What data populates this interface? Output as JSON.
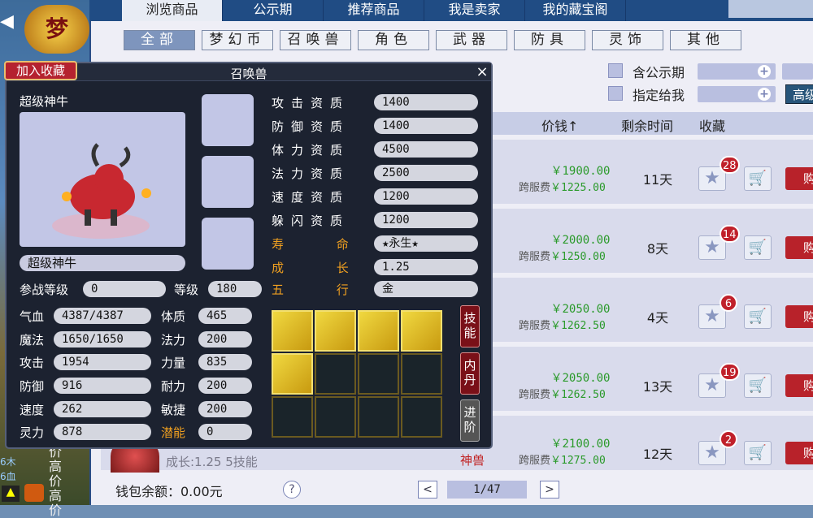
{
  "tabs": [
    "浏览商品",
    "公示期",
    "推荐商品",
    "我是卖家",
    "我的藏宝阁"
  ],
  "categories": [
    "全部",
    "梦幻币",
    "召唤兽",
    "角色",
    "武器",
    "防具",
    "灵饰",
    "其他"
  ],
  "filters": {
    "public": "含公示期",
    "assign": "指定给我",
    "advanced": "高级"
  },
  "table": {
    "price": "价钱↑",
    "remaining": "剩余时间",
    "favorite": "收藏"
  },
  "rows": [
    {
      "price": "￥1900.00",
      "fee_label": "跨服费",
      "fee": "￥1225.00",
      "days": "11天",
      "favs": "28"
    },
    {
      "price": "￥2000.00",
      "fee_label": "跨服费",
      "fee": "￥1250.00",
      "days": "8天",
      "favs": "14"
    },
    {
      "price": "￥2050.00",
      "fee_label": "跨服费",
      "fee": "￥1262.50",
      "days": "4天",
      "favs": "6"
    },
    {
      "price": "￥2050.00",
      "fee_label": "跨服费",
      "fee": "￥1262.50",
      "days": "13天",
      "favs": "19"
    },
    {
      "price": "￥2100.00",
      "fee_label": "跨服费",
      "fee": "￥1275.00",
      "days": "12天",
      "favs": "2"
    }
  ],
  "last_row_desc": "成长:1.25 5技能",
  "last_row_tag": "神兽",
  "buy_label": "购",
  "footer": {
    "wallet": "钱包余额：0.00元",
    "help": "?",
    "page": "1/47",
    "prev": "<",
    "next": ">"
  },
  "left_strip": {
    "banner": "梦",
    "labels": [
      "高价",
      "高价",
      "高价"
    ],
    "side_texts": [
      "6木",
      "6血"
    ]
  },
  "popup": {
    "title": "召唤兽",
    "close": "×",
    "favorite_button": "加入收藏",
    "pet_name": "超级神牛",
    "pet_name_field": "超级神牛",
    "aptitudes": [
      {
        "label": "攻击资质",
        "value": "1400"
      },
      {
        "label": "防御资质",
        "value": "1400"
      },
      {
        "label": "体力资质",
        "value": "4500"
      },
      {
        "label": "法力资质",
        "value": "2500"
      },
      {
        "label": "速度资质",
        "value": "1200"
      },
      {
        "label": "躲闪资质",
        "value": "1200"
      }
    ],
    "life": {
      "label": "寿 命",
      "value": "★永生★"
    },
    "growth": {
      "label": "成 长",
      "value": "1.25"
    },
    "element": {
      "label": "五 行",
      "value": "金"
    },
    "battle_level": {
      "label": "参战等级",
      "value": "0"
    },
    "level": {
      "label": "等级",
      "value": "180"
    },
    "stats_left": [
      {
        "label": "气血",
        "value": "4387/4387"
      },
      {
        "label": "魔法",
        "value": "1650/1650"
      },
      {
        "label": "攻击",
        "value": "1954"
      },
      {
        "label": "防御",
        "value": "916"
      },
      {
        "label": "速度",
        "value": "262"
      },
      {
        "label": "灵力",
        "value": "878"
      }
    ],
    "stats_right": [
      {
        "label": "体质",
        "value": "465"
      },
      {
        "label": "法力",
        "value": "200"
      },
      {
        "label": "力量",
        "value": "835"
      },
      {
        "label": "耐力",
        "value": "200"
      },
      {
        "label": "敏捷",
        "value": "200"
      },
      {
        "label": "潜能",
        "value": "0"
      }
    ],
    "side_buttons": [
      "技能",
      "内丹",
      "进阶"
    ]
  }
}
